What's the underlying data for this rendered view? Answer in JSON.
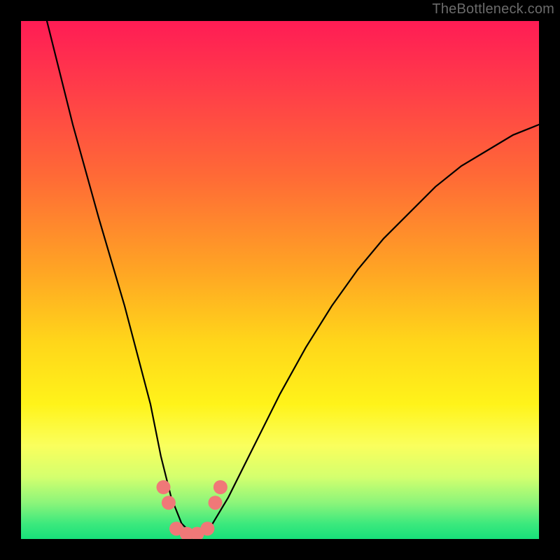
{
  "watermark": "TheBottleneck.com",
  "chart_data": {
    "type": "line",
    "title": "",
    "xlabel": "",
    "ylabel": "",
    "xlim": [
      0,
      100
    ],
    "ylim": [
      0,
      100
    ],
    "grid": false,
    "legend": false,
    "series": [
      {
        "name": "curve",
        "x": [
          5,
          10,
          15,
          20,
          25,
          27,
          29,
          31,
          33,
          35,
          37,
          40,
          45,
          50,
          55,
          60,
          65,
          70,
          75,
          80,
          85,
          90,
          95,
          100
        ],
        "y": [
          100,
          80,
          62,
          45,
          26,
          16,
          8,
          3,
          1,
          1,
          3,
          8,
          18,
          28,
          37,
          45,
          52,
          58,
          63,
          68,
          72,
          75,
          78,
          80
        ]
      }
    ],
    "highlight_points": {
      "name": "dots",
      "color": "#f07878",
      "x": [
        27.5,
        28.5,
        30,
        32,
        34,
        36,
        37.5,
        38.5
      ],
      "y": [
        10,
        7,
        2,
        1,
        1,
        2,
        7,
        10
      ]
    },
    "background_gradient": {
      "direction": "top-to-bottom",
      "stops": [
        {
          "pos": 0,
          "color": "#ff1c55"
        },
        {
          "pos": 30,
          "color": "#ff6a36"
        },
        {
          "pos": 62,
          "color": "#ffd61a"
        },
        {
          "pos": 82,
          "color": "#faff5d"
        },
        {
          "pos": 100,
          "color": "#17e07a"
        }
      ]
    }
  }
}
